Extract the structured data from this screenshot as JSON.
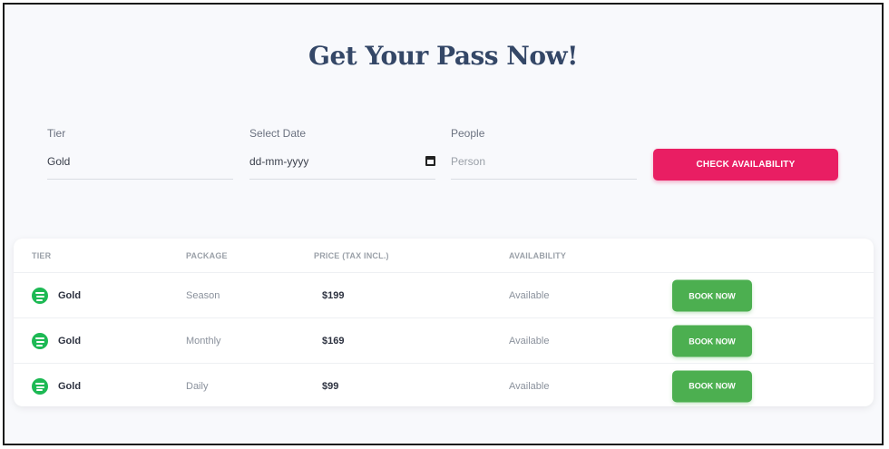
{
  "page": {
    "title": "Get Your Pass Now!"
  },
  "form": {
    "tier": {
      "label": "Tier",
      "value": "Gold"
    },
    "date": {
      "label": "Select Date",
      "value": "dd-mm-yyyy"
    },
    "people": {
      "label": "People",
      "placeholder": "Person",
      "value": ""
    },
    "check_button": "CHECK AVAILABILITY"
  },
  "table": {
    "headers": [
      "TIER",
      "PACKAGE",
      "PRICE (TAX INCL.)",
      "AVAILABILITY"
    ],
    "rows": [
      {
        "tier": "Gold",
        "package": "Season",
        "price": "$199",
        "availability": "Available",
        "action": "BOOK NOW",
        "icon": "spotify-icon"
      },
      {
        "tier": "Gold",
        "package": "Monthly",
        "price": "$169",
        "availability": "Available",
        "action": "BOOK NOW",
        "icon": "spotify-icon"
      },
      {
        "tier": "Gold",
        "package": "Daily",
        "price": "$99",
        "availability": "Available",
        "action": "BOOK NOW",
        "icon": "spotify-icon"
      }
    ]
  },
  "colors": {
    "accent": "#e91e63",
    "success": "#4caf50",
    "title": "#344767",
    "icon": "#1db954"
  }
}
